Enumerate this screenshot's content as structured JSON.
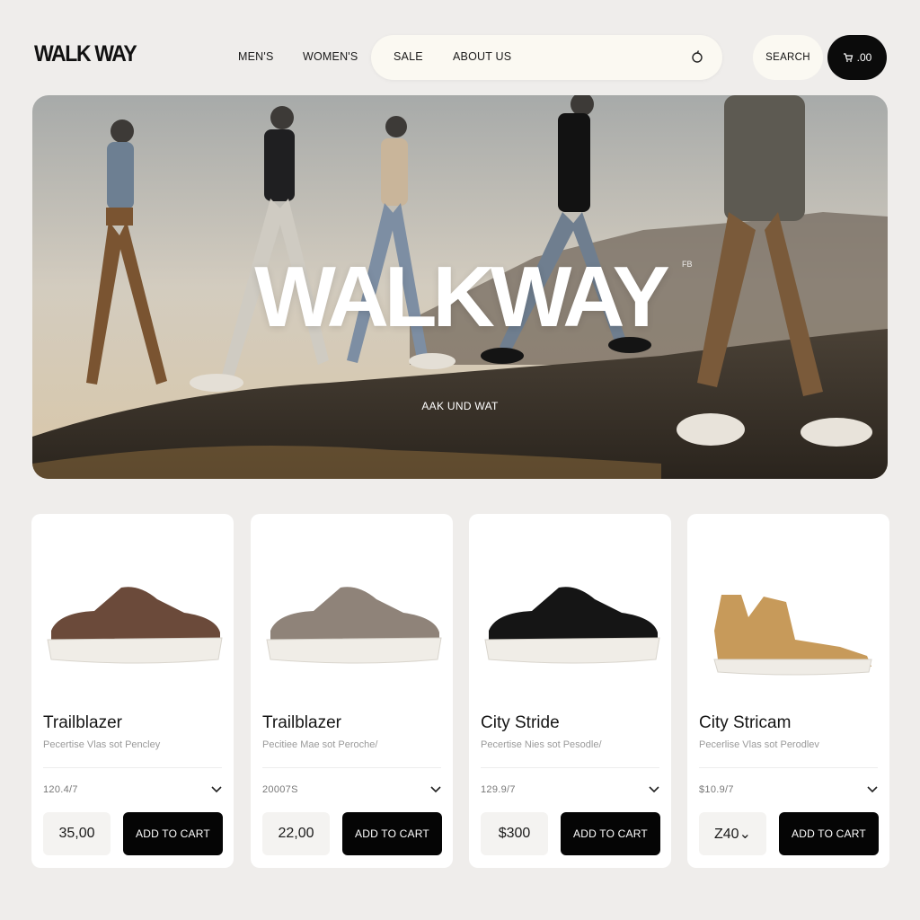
{
  "header": {
    "logo": "WALK WAY",
    "nav": [
      "MEN'S",
      "WOMEN'S",
      "SALE",
      "ABOUT US"
    ],
    "search_label": "SEARCH",
    "cart_label": ".00",
    "icons": {
      "search": "search-icon",
      "cart": "cart-icon"
    }
  },
  "hero": {
    "title": "WALKWAY",
    "mark": "FB",
    "tagline": "AAK UND WAT"
  },
  "products": [
    {
      "name": "Trailblazer",
      "desc": "Pecertise Vlas sot Pencley",
      "meta": "120.4/7",
      "price": "35,00",
      "cta": "ADD TO CART",
      "color": "#6b4a3a"
    },
    {
      "name": "Trailblazer",
      "desc": "Pecitiee Mae sot Peroche/",
      "meta": "20007S",
      "price": "22,00",
      "cta": "ADD TO CART",
      "color": "#8f8379"
    },
    {
      "name": "City Stride",
      "desc": "Pecertise Nies sot Pesodle/",
      "meta": "129.9/7",
      "price": "$300",
      "cta": "ADD TO CART",
      "color": "#151515"
    },
    {
      "name": "City Stricam",
      "desc": "Pecerlise Vlas sot Perodlev",
      "meta": "$10.9/7",
      "price": "Z40⌄",
      "cta": "ADD TO CART",
      "color": "#c79a5a"
    }
  ],
  "colors": {
    "page_bg": "#efedeb",
    "pill_bg": "#fbf9f2",
    "button_dark": "#050505"
  }
}
